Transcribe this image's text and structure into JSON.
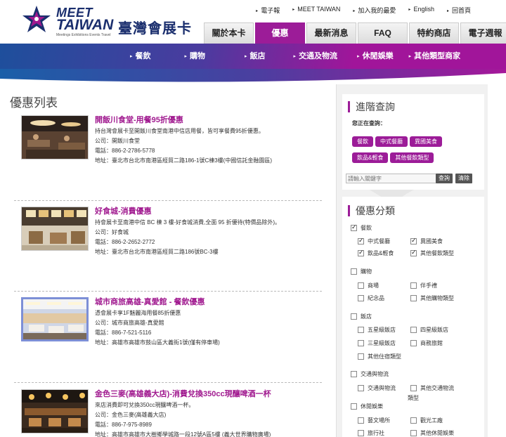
{
  "brand": {
    "meet": "MEET",
    "taiwan": "TAIWAN",
    "tagline": "Meetings Exhibitions Events Travel",
    "cn_name": "臺灣會展卡",
    "colors": {
      "navy": "#1b2f6e",
      "purple": "#9c1c98",
      "blue": "#1a5fa8"
    }
  },
  "util_links": [
    "電子報",
    "MEET TAIWAN",
    "加入我的最愛",
    "English",
    "回首頁"
  ],
  "tabs": [
    "關於本卡",
    "優惠",
    "最新消息",
    "FAQ",
    "特約商店",
    "電子週報"
  ],
  "active_tab": "優惠",
  "subnav": [
    "餐飲",
    "購物",
    "飯店",
    "交通及物流",
    "休閒娛樂",
    "其他類型商家"
  ],
  "main": {
    "title": "優惠列表",
    "items": [
      {
        "title": "開飯川食堂-用餐95折優惠",
        "desc": "持台灣會展卡至開飯川食堂南港中信店用餐，皆可享餐費95折優惠。",
        "company": "公司：開飯川食堂",
        "phone": "電話：886-2-2786-5778",
        "address": "地址：臺北市台北市南港區經貿二路186-1號C棟3樓(中國信託金融園區)"
      },
      {
        "title": "好食城-消費優惠",
        "desc": "持會展卡至南港中信 BC 棟 3 樓-好食城消費,全面 95 折優待(特價品除外)。",
        "company": "公司：好食城",
        "phone": "電話：886-2-2652-2772",
        "address": "地址：臺北市台北市南港區經貿二路186號BC-3樓"
      },
      {
        "title": "城市商旅高雄-真愛館 - 餐飲優惠",
        "desc": "憑會展卡享1F魅麗海用餐85折優惠",
        "company": "公司：城市商旅高雄-真愛館",
        "phone": "電話：886-7-521-5116",
        "address": "地址：高雄市高雄市鼓山區大義街1號(僅有停車場)"
      },
      {
        "title": "金色三麥(高雄義大店)-消費兌換350cc現釀啤酒一杯",
        "desc": "來店消費即可兌換350cc現釀啤酒一杯。",
        "company": "公司：金色三麥(高雄義大店)",
        "phone": "電話：886-7-975-8989",
        "address": "地址：高雄市高雄市大樹鄉學城路一段12號A區5樓 (義大世界購物廣場)"
      }
    ]
  },
  "sidebar": {
    "advanced_title": "進階查詢",
    "querying_label": "您正在查詢：",
    "pills": [
      "餐飲",
      "中式餐廳",
      "異國美食",
      "飲品&輕食",
      "其他餐飲類型"
    ],
    "search_placeholder": "請輸入關鍵字",
    "search_btn": "查詢",
    "clear_btn": "清除",
    "category_title": "優惠分類",
    "groups": [
      {
        "label": "餐飲",
        "checked": true,
        "items": [
          {
            "label": "中式餐廳",
            "checked": true
          },
          {
            "label": "異國美食",
            "checked": true
          },
          {
            "label": "飲品&輕食",
            "checked": true
          },
          {
            "label": "其他餐飲類型",
            "checked": true
          }
        ]
      },
      {
        "label": "購物",
        "checked": false,
        "items": [
          {
            "label": "商場",
            "checked": false
          },
          {
            "label": "伴手禮",
            "checked": false
          },
          {
            "label": "紀念品",
            "checked": false
          },
          {
            "label": "其他購物類型",
            "checked": false
          }
        ]
      },
      {
        "label": "飯店",
        "checked": false,
        "items": [
          {
            "label": "五星級飯店",
            "checked": false
          },
          {
            "label": "四星級飯店",
            "checked": false
          },
          {
            "label": "三星級飯店",
            "checked": false
          },
          {
            "label": "商務旅館",
            "checked": false
          },
          {
            "label": "其他住宿類型",
            "checked": false
          }
        ]
      },
      {
        "label": "交通與物流",
        "checked": false,
        "items": [
          {
            "label": "交通與物流",
            "checked": false
          },
          {
            "label": "其他交通物流",
            "checked": false
          },
          {
            "label": "類型",
            "checked": false
          }
        ]
      },
      {
        "label": "休閒娛樂",
        "checked": false,
        "items": [
          {
            "label": "藝文場所",
            "checked": false
          },
          {
            "label": "觀光工廠",
            "checked": false
          },
          {
            "label": "旅行社",
            "checked": false
          },
          {
            "label": "其他休閒娛樂",
            "checked": false
          }
        ]
      }
    ]
  }
}
